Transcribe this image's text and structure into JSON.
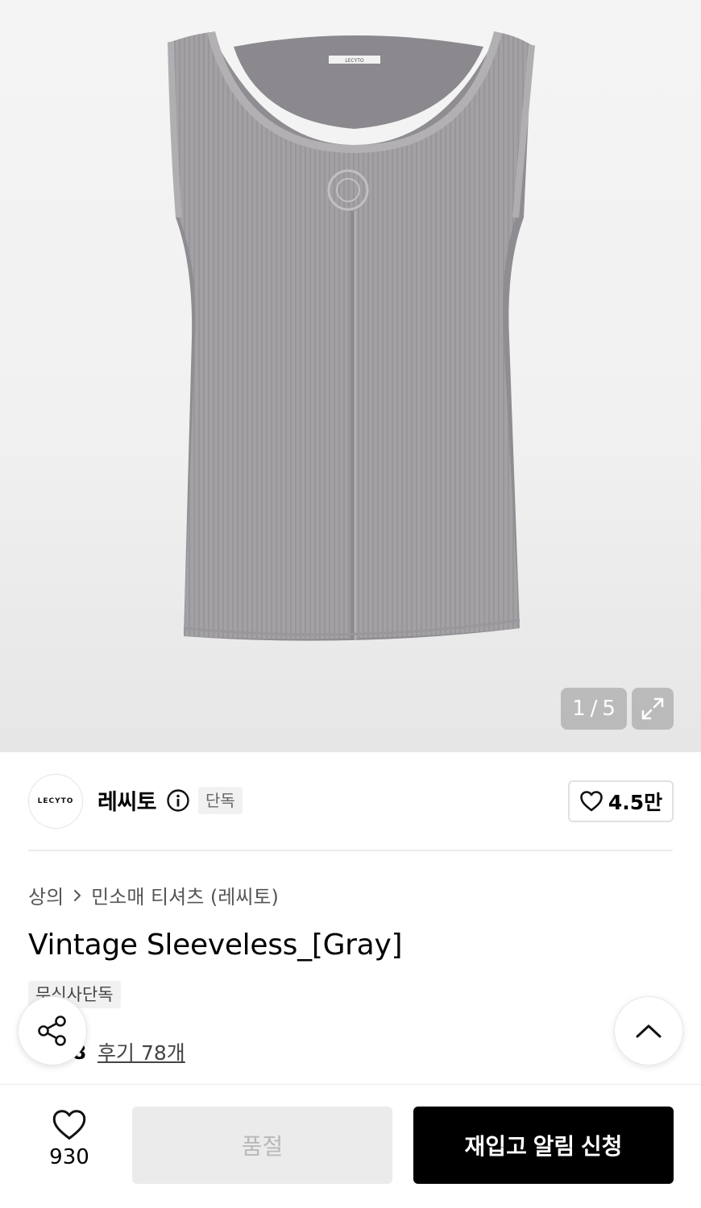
{
  "gallery": {
    "current": "1",
    "separator": "/",
    "total": "5",
    "label_on_garment": "LECYTO"
  },
  "brand": {
    "logo_text": "LECYTO",
    "name": "레씨토",
    "badge": "단독",
    "likes": "4.5만"
  },
  "breadcrumb": {
    "category": "상의",
    "subcategory": "민소매 티셔츠 (레씨토)"
  },
  "product": {
    "title": "Vintage Sleeveless_[Gray]",
    "badge": "무신사단독"
  },
  "rating": {
    "score": "4.8",
    "reviews": "후기 78개"
  },
  "bottom_bar": {
    "wish_count": "930",
    "soldout_label": "품절",
    "restock_label": "재입고 알림 신청"
  },
  "colors": {
    "garment": "#a19fa2",
    "accent_black": "#000000",
    "star": "#f6b400"
  }
}
